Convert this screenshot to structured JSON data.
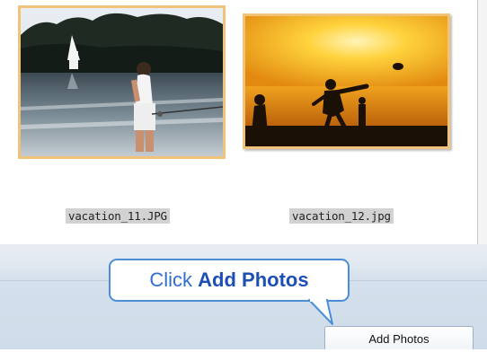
{
  "photos": [
    {
      "filename": "vacation_11.JPG"
    },
    {
      "filename": "vacation_12.jpg"
    }
  ],
  "callout": {
    "prefix": "Click ",
    "bold": "Add Photos"
  },
  "toolbar": {
    "add_photos_label": "Add Photos"
  },
  "colors": {
    "thumb_border": "#f0c27a",
    "callout_border": "#4a8fd6",
    "callout_text": "#2f6fd1",
    "toolbar_bg": "#d4e0ec"
  }
}
